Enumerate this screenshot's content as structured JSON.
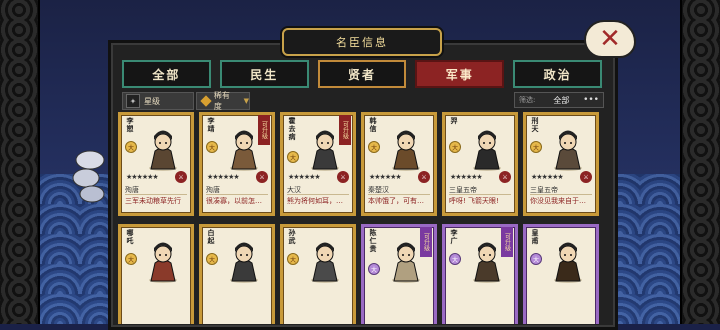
{
  "window": {
    "title": "名臣信息"
  },
  "close": {
    "icon": "close-x-icon"
  },
  "tabs": [
    {
      "label": "全部",
      "state": "normal",
      "style": "green"
    },
    {
      "label": "民生",
      "state": "normal",
      "style": "green"
    },
    {
      "label": "贤者",
      "state": "normal",
      "style": "gold"
    },
    {
      "label": "军事",
      "state": "active",
      "style": "red"
    },
    {
      "label": "政治",
      "state": "normal",
      "style": "green"
    }
  ],
  "filters": {
    "star_label": "星级",
    "rarity_label": "稀有度",
    "pick_label": "筛选:",
    "pick_value": "全部",
    "more": "•••"
  },
  "cards": [
    {
      "name": "李愬",
      "seal": "大",
      "tier": "gold",
      "ribbon": "",
      "faction": "殉唐",
      "quote": "三军未动粮草先行",
      "stars": "★★★★★★"
    },
    {
      "name": "李靖",
      "seal": "大",
      "tier": "gold",
      "ribbon": "可升级",
      "faction": "殉唐",
      "quote": "很凑寡，以前怎么没见你用过大斧?",
      "stars": "★★★★★★"
    },
    {
      "name": "霍去病",
      "seal": "大",
      "tier": "gold",
      "ribbon": "可升级",
      "faction": "大汉",
      "quote": "熊为将何如耳，不至学古兵法",
      "stars": "★★★★★★"
    },
    {
      "name": "韩信",
      "seal": "大",
      "tier": "gold",
      "ribbon": "",
      "faction": "秦楚汉",
      "quote": "本帅饿了，可有饭团吗?",
      "stars": "★★★★★★"
    },
    {
      "name": "羿",
      "seal": "大",
      "tier": "gold",
      "ribbon": "",
      "faction": "三皇五帝",
      "quote": "呼呀! 飞箭天眼!",
      "stars": "★★★★★★"
    },
    {
      "name": "刑天",
      "seal": "大",
      "tier": "gold",
      "ribbon": "",
      "faction": "三皇五帝",
      "quote": "你没见我来自于戚樹鬼",
      "stars": "★★★★★★"
    },
    {
      "name": "哪吒",
      "seal": "大",
      "tier": "gold",
      "ribbon": "",
      "faction": "",
      "quote": "",
      "stars": ""
    },
    {
      "name": "白起",
      "seal": "大",
      "tier": "gold",
      "ribbon": "",
      "faction": "",
      "quote": "",
      "stars": ""
    },
    {
      "name": "孙武",
      "seal": "大",
      "tier": "gold",
      "ribbon": "",
      "faction": "",
      "quote": "",
      "stars": ""
    },
    {
      "name": "陈仁贵",
      "seal": "大",
      "tier": "purple",
      "ribbon": "可升级",
      "faction": "",
      "quote": "",
      "stars": ""
    },
    {
      "name": "李广",
      "seal": "大",
      "tier": "purple",
      "ribbon": "可升级",
      "faction": "",
      "quote": "",
      "stars": ""
    },
    {
      "name": "皇甫",
      "seal": "大",
      "tier": "purple",
      "ribbon": "",
      "faction": "",
      "quote": "",
      "stars": ""
    }
  ],
  "colors": {
    "panel": "#222222",
    "gold_border": "#c89a3a",
    "purple_border": "#9a6ac4",
    "active_tab": "#8c2323",
    "accent_text": "#f3dd9c"
  }
}
